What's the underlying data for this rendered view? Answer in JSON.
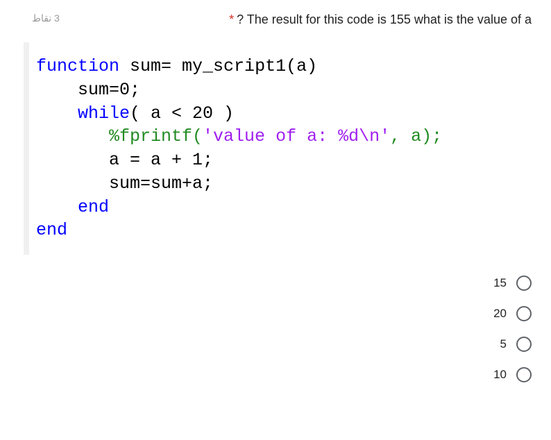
{
  "header": {
    "points": "3 نقاط",
    "asterisk": "*",
    "question": "? The result for this code is 155 what is the value of a"
  },
  "code": {
    "line1_kw": "function",
    "line1_rest": " sum= my_script1(a)",
    "line2": "    sum=0;",
    "line3_a": "    ",
    "line3_kw": "while",
    "line3_b": "( a < 20 )",
    "line4_a": "       %fprintf(",
    "line4_str": "'value of a: %d\\n'",
    "line4_b": ", a);",
    "line5": "       a = a + 1;",
    "line6": "       sum=sum+a;",
    "line7_a": "    ",
    "line7_kw": "end",
    "line8_kw": "end"
  },
  "options": [
    {
      "label": "15"
    },
    {
      "label": "20"
    },
    {
      "label": "5"
    },
    {
      "label": "10"
    }
  ]
}
